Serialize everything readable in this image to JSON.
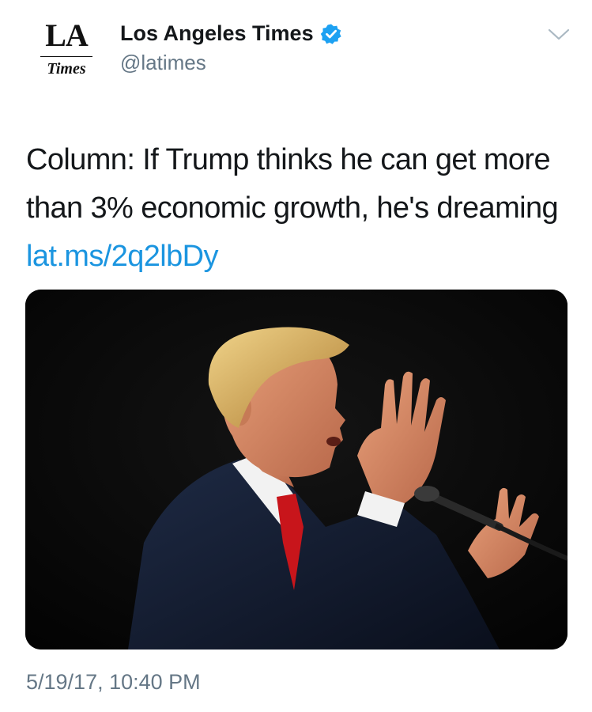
{
  "account": {
    "logo_top": "LA",
    "logo_bottom": "Times",
    "display_name": "Los Angeles Times",
    "handle": "@latimes",
    "verified": true
  },
  "tweet": {
    "text": "Column: If Trump thinks he can get more than 3% economic growth, he's dreaming ",
    "link": "lat.ms/2q2lbDy"
  },
  "media": {
    "type": "photo"
  },
  "meta": {
    "timestamp": "5/19/17, 10:40 PM"
  },
  "icons": {
    "verified": "verified-badge-icon",
    "menu": "chevron-down-icon"
  },
  "colors": {
    "link": "#1b95e0",
    "verified_badge": "#1da1f2",
    "secondary_text": "#657786",
    "primary_text": "#14171a"
  }
}
